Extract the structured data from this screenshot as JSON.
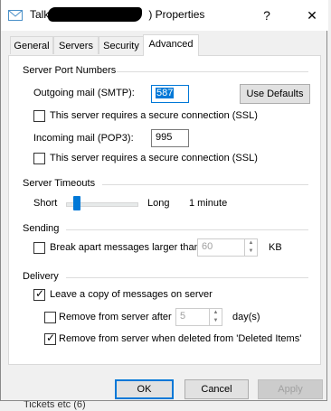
{
  "window": {
    "title_prefix": "Talktalk (",
    "title_suffix": ") Properties",
    "help_glyph": "?",
    "close_glyph": "✕"
  },
  "tabs": [
    {
      "label": "General",
      "active": false
    },
    {
      "label": "Servers",
      "active": false
    },
    {
      "label": "Security",
      "active": false
    },
    {
      "label": "Advanced",
      "active": true
    }
  ],
  "server_ports": {
    "group_title": "Server Port Numbers",
    "outgoing_label": "Outgoing mail (SMTP):",
    "outgoing_value": "587",
    "use_defaults_label": "Use Defaults",
    "smtp_ssl_label": "This server requires a secure connection (SSL)",
    "smtp_ssl_checked": false,
    "incoming_label": "Incoming mail (POP3):",
    "incoming_value": "995",
    "pop_ssl_label": "This server requires a secure connection (SSL)",
    "pop_ssl_checked": false
  },
  "timeouts": {
    "group_title": "Server Timeouts",
    "short_label": "Short",
    "long_label": "Long",
    "value_text": "1 minute",
    "slider_level": 0.1
  },
  "sending": {
    "group_title": "Sending",
    "break_apart_label": "Break apart messages larger than",
    "break_apart_checked": false,
    "size_value": "60",
    "size_unit": "KB"
  },
  "delivery": {
    "group_title": "Delivery",
    "leave_copy_label": "Leave a copy of messages on server",
    "leave_copy_checked": true,
    "remove_after_label": "Remove from server after",
    "remove_after_checked": false,
    "days_value": "5",
    "days_unit": "day(s)",
    "remove_deleted_label": "Remove from server when deleted from 'Deleted Items'",
    "remove_deleted_checked": true
  },
  "footer": {
    "ok_label": "OK",
    "cancel_label": "Cancel",
    "apply_label": "Apply"
  },
  "background": {
    "partial_text": "Tickets etc (6)"
  }
}
